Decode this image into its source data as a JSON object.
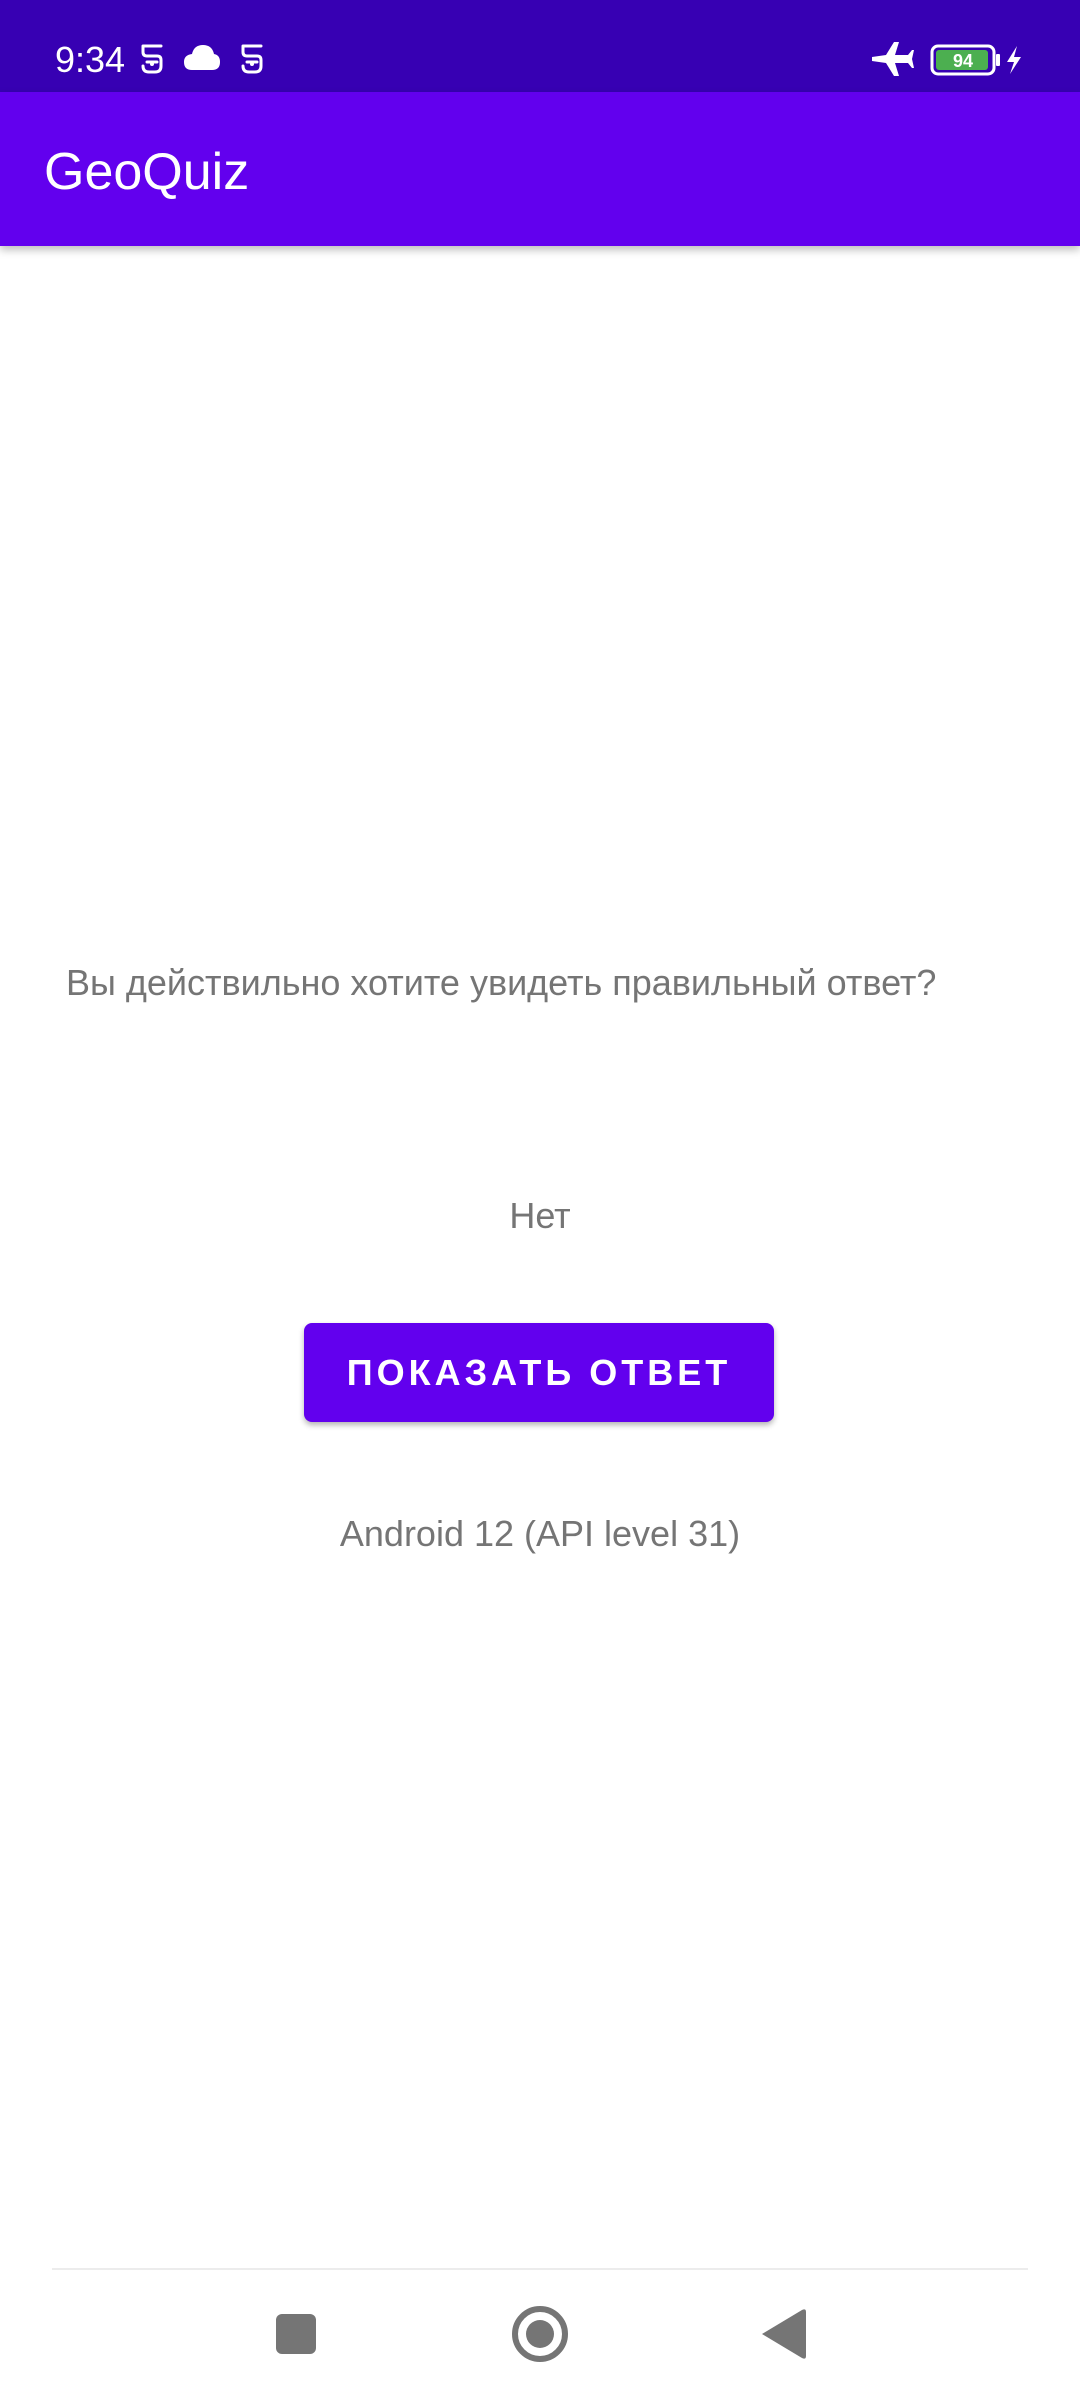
{
  "status_bar": {
    "time": "9:34",
    "battery_level": "94",
    "icons": [
      "notification-app-icon",
      "cloud-icon",
      "notification-app-icon",
      "airplane-mode-icon",
      "battery-icon",
      "charging-icon"
    ],
    "background_color": "#3700B3",
    "battery_fill_color": "#4CAF50"
  },
  "app_bar": {
    "title": "GeoQuiz",
    "color": "#6200EE"
  },
  "main": {
    "question": "Вы действильно хотите увидеть правильный ответ?",
    "answer": "Нет",
    "show_answer_button": "ПОКАЗАТЬ ОТВЕТ",
    "api_info": "Android 12 (API level 31)"
  },
  "nav_bar": {
    "icons": [
      "recents-square-icon",
      "home-circle-icon",
      "back-triangle-icon"
    ]
  }
}
